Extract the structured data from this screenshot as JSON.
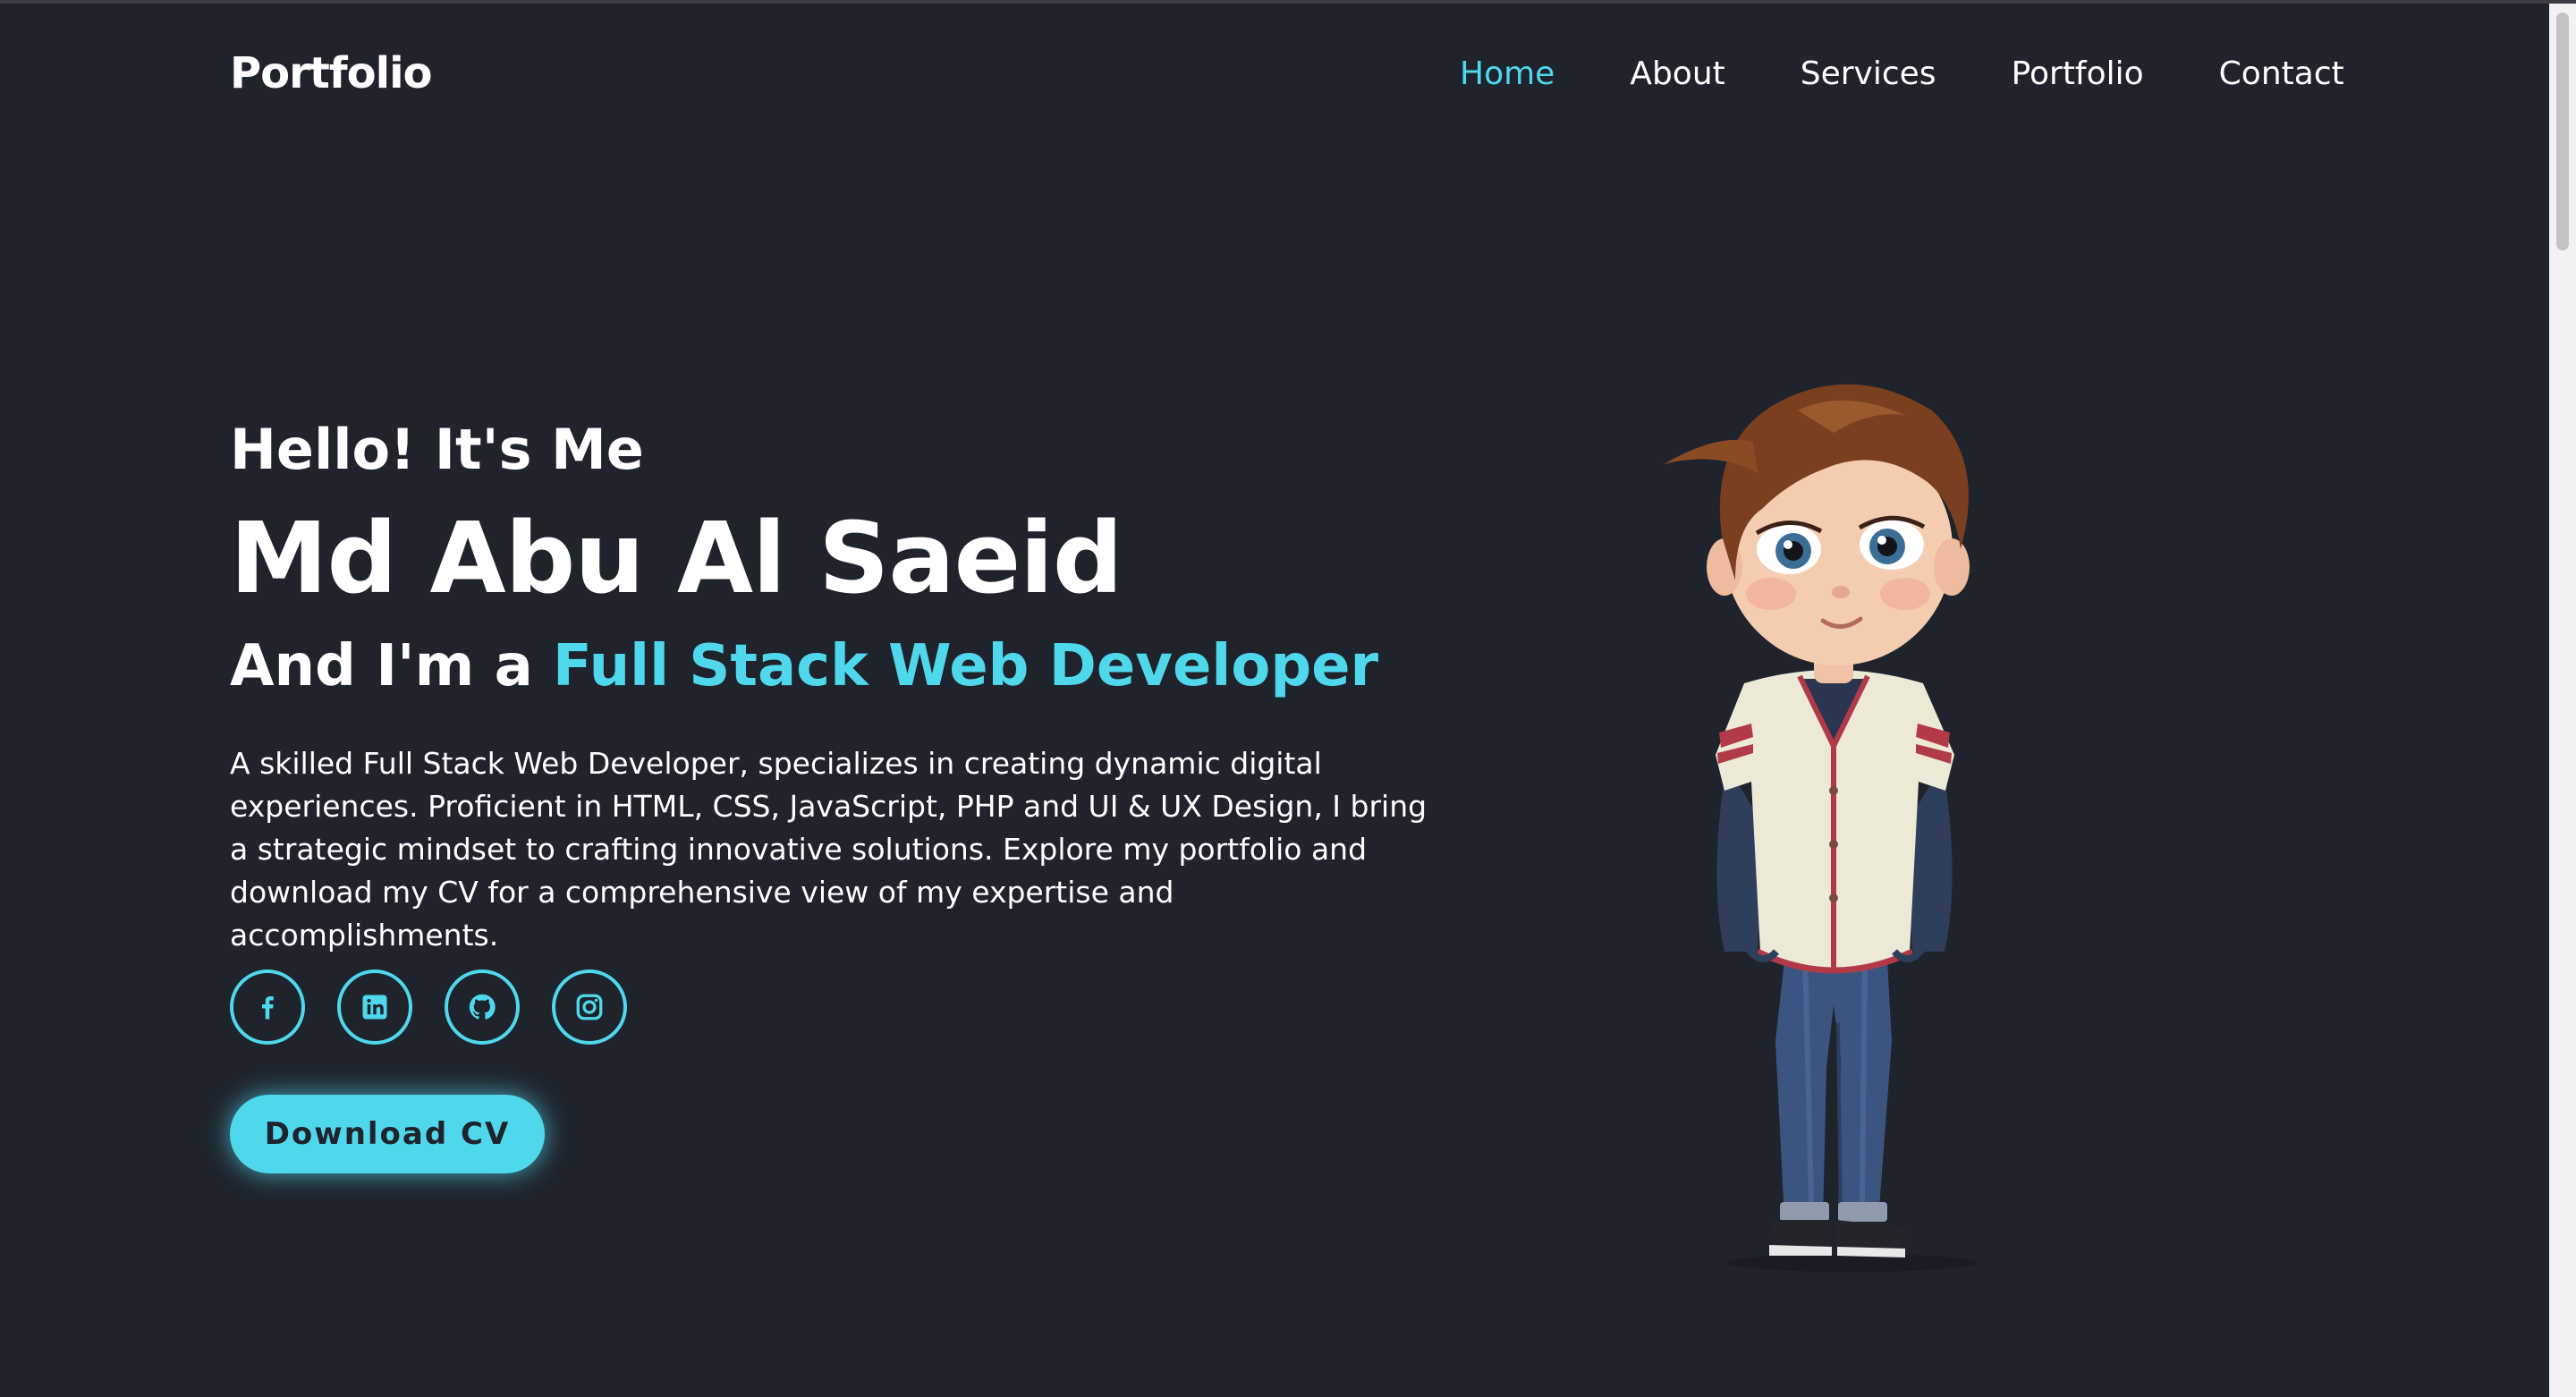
{
  "header": {
    "logo": "Portfolio",
    "nav": [
      {
        "label": "Home",
        "active": true
      },
      {
        "label": "About",
        "active": false
      },
      {
        "label": "Services",
        "active": false
      },
      {
        "label": "Portfolio",
        "active": false
      },
      {
        "label": "Contact",
        "active": false
      }
    ]
  },
  "hero": {
    "greeting": "Hello! It's Me",
    "name": "Md Abu Al Saeid",
    "role_prefix": "And I'm a ",
    "role_highlight": "Full Stack Web Developer",
    "description": "A skilled Full Stack Web Developer, specializes in creating dynamic digital experiences. Proficient in HTML, CSS, JavaScript, PHP and UI & UX Design, I bring a strategic mindset to crafting innovative solutions. Explore my portfolio and download my CV for a comprehensive view of my expertise and accomplishments.",
    "socials": [
      "facebook-icon",
      "linkedin-icon",
      "github-icon",
      "instagram-icon"
    ],
    "cta_label": "Download CV",
    "illustration": "cartoon-boy-character"
  },
  "colors": {
    "background": "#1f232c",
    "accent": "#4fd8ec",
    "text": "#ffffff"
  }
}
